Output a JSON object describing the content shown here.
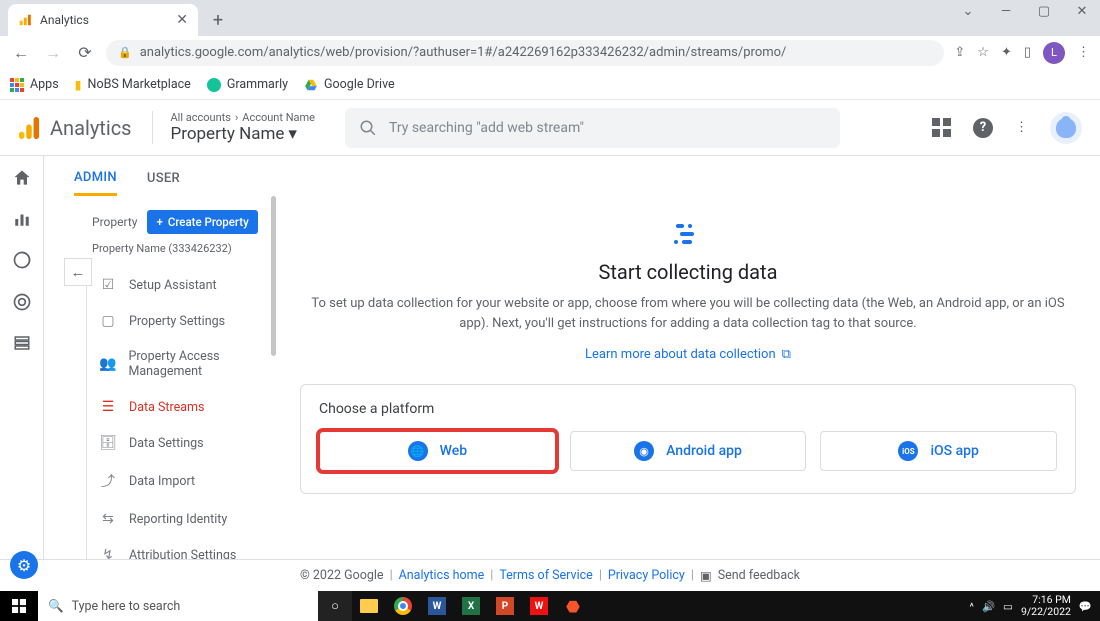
{
  "browser": {
    "tab_title": "Analytics",
    "url": "analytics.google.com/analytics/web/provision/?authuser=1#/a242269162p333426232/admin/streams/promo/",
    "bookmarks": [
      "Apps",
      "NoBS Marketplace",
      "Grammarly",
      "Google Drive"
    ]
  },
  "header": {
    "product": "Analytics",
    "crumb_all": "All accounts",
    "crumb_account": "Account Name",
    "property_name": "Property Name",
    "search_placeholder": "Try searching \"add web stream\""
  },
  "tabs": {
    "admin": "ADMIN",
    "user": "USER"
  },
  "property": {
    "label": "Property",
    "create_btn": "Create Property",
    "subtitle": "Property Name (333426232)",
    "menu": [
      "Setup Assistant",
      "Property Settings",
      "Property Access Management",
      "Data Streams",
      "Data Settings",
      "Data Import",
      "Reporting Identity",
      "Attribution Settings"
    ]
  },
  "main": {
    "title": "Start collecting data",
    "desc": "To set up data collection for your website or app, choose from where you will be collecting data (the Web, an Android app, or an iOS app). Next, you'll get instructions for adding a data collection tag to that source.",
    "learn_more": "Learn more about data collection",
    "choose": "Choose a platform",
    "platforms": {
      "web": "Web",
      "android": "Android app",
      "ios": "iOS app"
    }
  },
  "footer": {
    "copyright": "© 2022 Google",
    "links": [
      "Analytics home",
      "Terms of Service",
      "Privacy Policy"
    ],
    "feedback": "Send feedback"
  },
  "taskbar": {
    "search_placeholder": "Type here to search",
    "time": "7:16 PM",
    "date": "9/22/2022"
  }
}
